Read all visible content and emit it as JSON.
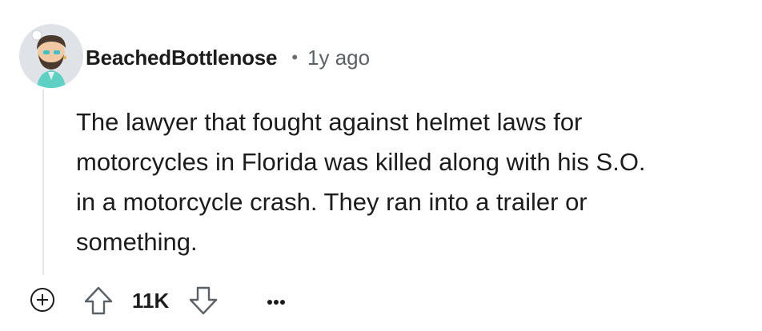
{
  "comment": {
    "author": "BeachedBottlenose",
    "separator": "•",
    "timestamp": "1y ago",
    "body": "The lawyer that fought against helmet laws for\nmotorcycles in Florida was killed along with his S.O.\nin a motorcycle crash. They ran into a trailer or\nsomething.",
    "score": "11K"
  },
  "icons": {
    "avatar": "avatar-image",
    "expand": "plus-circle-icon",
    "upvote": "upvote-arrow-icon",
    "downvote": "downvote-arrow-icon",
    "more": "ellipsis-icon"
  },
  "colors": {
    "text": "#1c1c1c",
    "muted": "#5c6166",
    "thread_line": "#e3e5e8",
    "avatar_bg": "#dfe3e8"
  }
}
